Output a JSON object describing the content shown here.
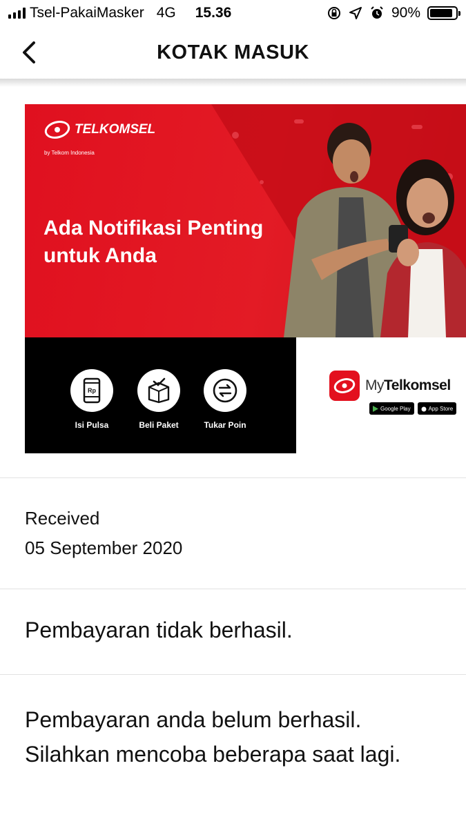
{
  "status_bar": {
    "carrier": "Tsel-PakaiMasker",
    "network": "4G",
    "time": "15.36",
    "battery": "90%",
    "battery_level": 0.9
  },
  "nav": {
    "title": "KOTAK MASUK",
    "back_icon": "chevron-left-icon"
  },
  "banner": {
    "brand": "TELKOMSEL",
    "brand_sub": "by Telkom Indonesia",
    "headline_line1": "Ada Notifikasi Penting",
    "headline_line2": "untuk Anda",
    "features": [
      {
        "label": "Isi Pulsa",
        "icon": "phone-rp-icon"
      },
      {
        "label": "Beli Paket",
        "icon": "package-box-icon"
      },
      {
        "label": "Tukar Poin",
        "icon": "exchange-arrows-icon"
      }
    ],
    "app_name_prefix": "My",
    "app_name_bold": "Telkomsel",
    "store_google": "Google Play",
    "store_apple": "App Store",
    "brand_color": "#e3101e"
  },
  "message": {
    "received_label": "Received",
    "received_date": "05 September 2020",
    "subject": "Pembayaran tidak berhasil.",
    "body_line1": "Pembayaran anda belum berhasil.",
    "body_line2": "Silahkan mencoba beberapa saat lagi."
  }
}
